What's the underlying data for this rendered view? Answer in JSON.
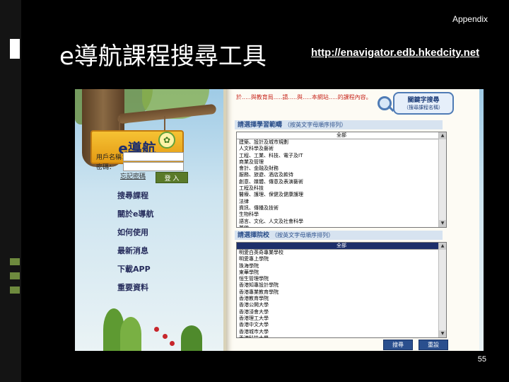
{
  "slide": {
    "appendix_label": "Appendix",
    "title": "e導航課程搜尋工具",
    "url": "http://enavigator.edb.hkedcity.net",
    "page_number": "55"
  },
  "colors": {
    "background": "#000000",
    "link_text": "#ffffff",
    "menu_text": "#262c5c",
    "note_text": "#c8281e",
    "button_blue": "#2a4f8e"
  },
  "site": {
    "logo_text": "e導航",
    "login": {
      "username_label": "用戶名稱：",
      "password_label": "密碼：",
      "forgot_label": "忘記密碼",
      "login_button": "登 入"
    },
    "menu": [
      "搜尋課程",
      "關於e導航",
      "如何使用",
      "最新消息",
      "下載APP",
      "重要資料"
    ],
    "note": "於.....與教育局.....請.....與.....本網站.....的課程內容。",
    "keyword_search": {
      "title": "關鍵字搜尋",
      "subtitle": "（搜尋課程名稱）"
    },
    "learning_areas": {
      "heading": "請選擇學習範疇",
      "hint": "（按英文字母順序排列）",
      "all_option": "全部",
      "options": [
        "建築、設計及城市規劃",
        "人文科學及藝術",
        "工程、工業、科技、電子及IT",
        "商業及管理",
        "會計、金融及財務",
        "服務、旅遊、酒店及款待",
        "創意、媒體、傳意及表演藝術",
        "工程及科技",
        "醫療、護理、保健及健康護理",
        "法律",
        "資訊、傳播及技術",
        "生物科學",
        "語言、文化、人文及社會科學",
        "其他"
      ]
    },
    "institutions": {
      "heading": "請選擇院校",
      "hint": "（按英文字母順序排列）",
      "all_option": "全部",
      "options": [
        "明愛白英奇專業學校",
        "明愛專上學院",
        "珠海學院",
        "東華學院",
        "恒生管理學院",
        "香港知專設計學院",
        "香港專業教育學院",
        "香港教育學院",
        "香港公開大學",
        "香港浸會大學",
        "香港理工大學",
        "香港中文大學",
        "香港城市大學",
        "香港科技大學",
        "香港大學",
        "嶺南大學"
      ]
    },
    "buttons": {
      "search": "搜尋",
      "reset": "重設"
    }
  }
}
